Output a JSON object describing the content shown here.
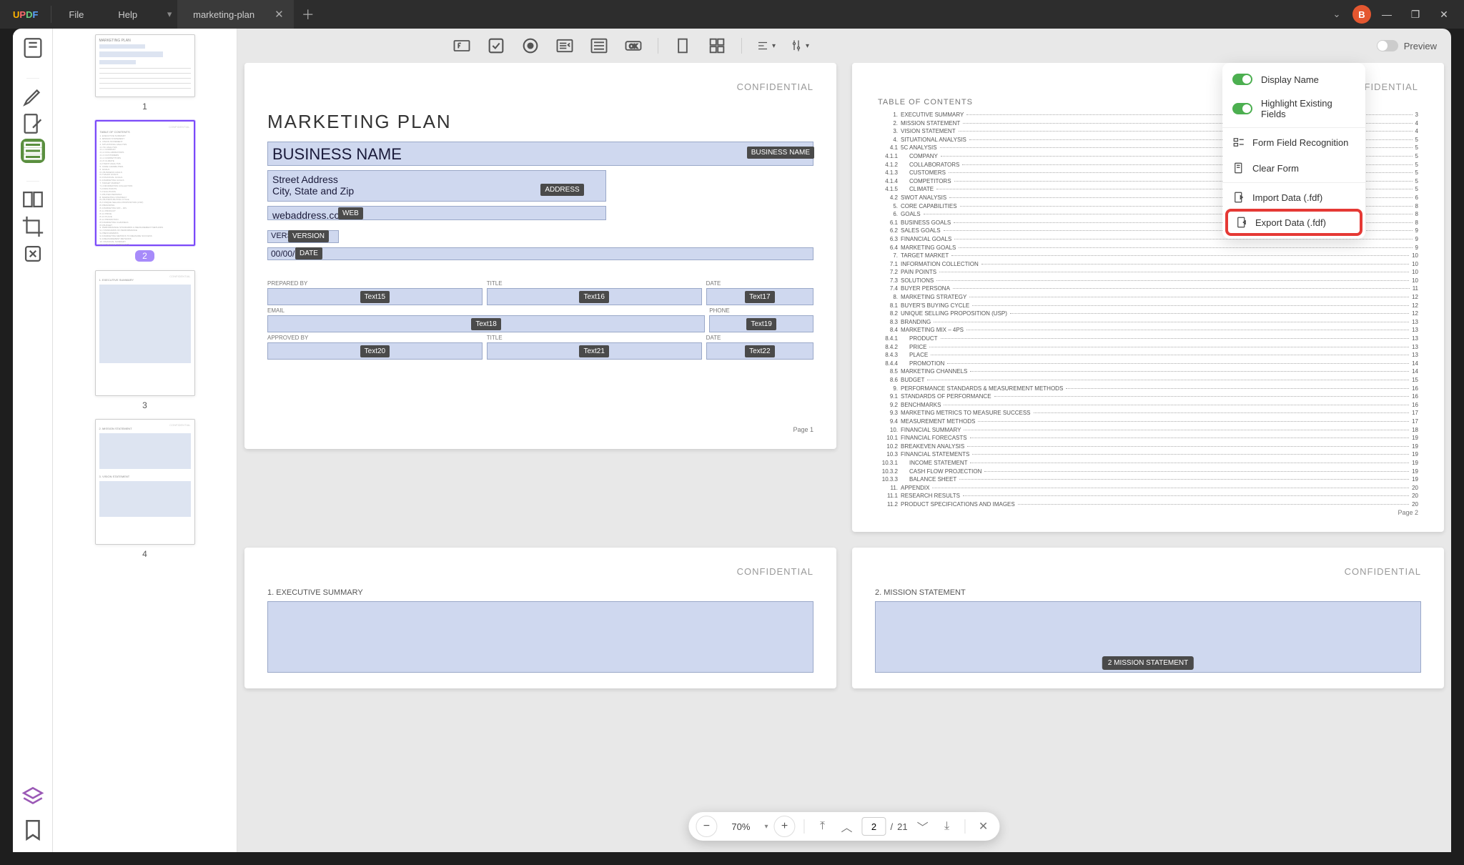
{
  "titlebar": {
    "file": "File",
    "help": "Help",
    "tab_name": "marketing-plan",
    "avatar_letter": "B"
  },
  "toolbar": {
    "preview_label": "Preview"
  },
  "dropdown": {
    "display_name": "Display Name",
    "highlight": "Highlight Existing Fields",
    "recognition": "Form Field Recognition",
    "clear": "Clear Form",
    "import": "Import Data (.fdf)",
    "export": "Export Data (.fdf)"
  },
  "thumbs": {
    "p1": "1",
    "p2": "2",
    "p3": "3",
    "p4": "4"
  },
  "page1": {
    "confidential": "CONFIDENTIAL",
    "title": "MARKETING PLAN",
    "business_name": "BUSINESS NAME",
    "business_tag": "BUSINESS NAME",
    "address_l1": "Street Address",
    "address_l2": "City, State and Zip",
    "address_tag": "ADDRESS",
    "web": "webaddress.com",
    "web_tag": "WEB",
    "vers": "VERS",
    "version_tag": "VERSION",
    "date": "00/00/",
    "date_tag": "DATE",
    "label_prepared": "PREPARED BY",
    "label_title": "TITLE",
    "label_date": "DATE",
    "label_email": "EMAIL",
    "label_phone": "PHONE",
    "label_approved": "APPROVED BY",
    "t15": "Text15",
    "t16": "Text16",
    "t17": "Text17",
    "t18": "Text18",
    "t19": "Text19",
    "t20": "Text20",
    "t21": "Text21",
    "t22": "Text22",
    "pagenum": "Page 1"
  },
  "page2": {
    "confidential": "CONFIDENTIAL",
    "toc_title": "TABLE OF CONTENTS",
    "pagenum": "Page 2",
    "toc": [
      {
        "n": "1.",
        "t": "EXECUTIVE SUMMARY",
        "p": "3"
      },
      {
        "n": "2.",
        "t": "MISSION STATEMENT",
        "p": "4"
      },
      {
        "n": "3.",
        "t": "VISION STATEMENT",
        "p": "4"
      },
      {
        "n": "4.",
        "t": "SITUATIONAL ANALYSIS",
        "p": "5"
      },
      {
        "n": "4.1",
        "t": "5C ANALYSIS",
        "p": "5"
      },
      {
        "n": "4.1.1",
        "t": "COMPANY",
        "p": "5"
      },
      {
        "n": "4.1.2",
        "t": "COLLABORATORS",
        "p": "5"
      },
      {
        "n": "4.1.3",
        "t": "CUSTOMERS",
        "p": "5"
      },
      {
        "n": "4.1.4",
        "t": "COMPETITORS",
        "p": "5"
      },
      {
        "n": "4.1.5",
        "t": "CLIMATE",
        "p": "5"
      },
      {
        "n": "4.2",
        "t": "SWOT ANALYSIS",
        "p": "6"
      },
      {
        "n": "5.",
        "t": "CORE CAPABILITIES",
        "p": "8"
      },
      {
        "n": "6.",
        "t": "GOALS",
        "p": "8"
      },
      {
        "n": "6.1",
        "t": "BUSINESS GOALS",
        "p": "8"
      },
      {
        "n": "6.2",
        "t": "SALES GOALS",
        "p": "9"
      },
      {
        "n": "6.3",
        "t": "FINANCIAL GOALS",
        "p": "9"
      },
      {
        "n": "6.4",
        "t": "MARKETING GOALS",
        "p": "9"
      },
      {
        "n": "7.",
        "t": "TARGET MARKET",
        "p": "10"
      },
      {
        "n": "7.1",
        "t": "INFORMATION COLLECTION",
        "p": "10"
      },
      {
        "n": "7.2",
        "t": "PAIN POINTS",
        "p": "10"
      },
      {
        "n": "7.3",
        "t": "SOLUTIONS",
        "p": "10"
      },
      {
        "n": "7.4",
        "t": "BUYER PERSONA",
        "p": "11"
      },
      {
        "n": "8.",
        "t": "MARKETING STRATEGY",
        "p": "12"
      },
      {
        "n": "8.1",
        "t": "BUYER'S BUYING CYCLE",
        "p": "12"
      },
      {
        "n": "8.2",
        "t": "UNIQUE SELLING PROPOSITION (USP)",
        "p": "12"
      },
      {
        "n": "8.3",
        "t": "BRANDING",
        "p": "13"
      },
      {
        "n": "8.4",
        "t": "MARKETING MIX – 4Ps",
        "p": "13"
      },
      {
        "n": "8.4.1",
        "t": "PRODUCT",
        "p": "13"
      },
      {
        "n": "8.4.2",
        "t": "PRICE",
        "p": "13"
      },
      {
        "n": "8.4.3",
        "t": "PLACE",
        "p": "13"
      },
      {
        "n": "8.4.4",
        "t": "PROMOTION",
        "p": "14"
      },
      {
        "n": "8.5",
        "t": "MARKETING CHANNELS",
        "p": "14"
      },
      {
        "n": "8.6",
        "t": "BUDGET",
        "p": "15"
      },
      {
        "n": "9.",
        "t": "PERFORMANCE STANDARDS & MEASUREMENT METHODS",
        "p": "16"
      },
      {
        "n": "9.1",
        "t": "STANDARDS OF PERFORMANCE",
        "p": "16"
      },
      {
        "n": "9.2",
        "t": "BENCHMARKS",
        "p": "16"
      },
      {
        "n": "9.3",
        "t": "MARKETING METRICS TO MEASURE SUCCESS",
        "p": "17"
      },
      {
        "n": "9.4",
        "t": "MEASUREMENT METHODS",
        "p": "17"
      },
      {
        "n": "10.",
        "t": "FINANCIAL SUMMARY",
        "p": "18"
      },
      {
        "n": "10.1",
        "t": "FINANCIAL FORECASTS",
        "p": "19"
      },
      {
        "n": "10.2",
        "t": "BREAKEVEN ANALYSIS",
        "p": "19"
      },
      {
        "n": "10.3",
        "t": "FINANCIAL STATEMENTS",
        "p": "19"
      },
      {
        "n": "10.3.1",
        "t": "INCOME STATEMENT",
        "p": "19"
      },
      {
        "n": "10.3.2",
        "t": "CASH FLOW PROJECTION",
        "p": "19"
      },
      {
        "n": "10.3.3",
        "t": "BALANCE SHEET",
        "p": "19"
      },
      {
        "n": "11.",
        "t": "APPENDIX",
        "p": "20"
      },
      {
        "n": "11.1",
        "t": "RESEARCH RESULTS",
        "p": "20"
      },
      {
        "n": "11.2",
        "t": "PRODUCT SPECIFICATIONS AND IMAGES",
        "p": "20"
      }
    ]
  },
  "page3": {
    "confidential": "CONFIDENTIAL",
    "section": "1.  EXECUTIVE SUMMARY"
  },
  "page4": {
    "confidential": "CONFIDENTIAL",
    "section": "2.  MISSION STATEMENT",
    "field_tag": "2 MISSION STATEMENT"
  },
  "bottombar": {
    "zoom": "70%",
    "current": "2",
    "sep": "/",
    "total": "21"
  }
}
